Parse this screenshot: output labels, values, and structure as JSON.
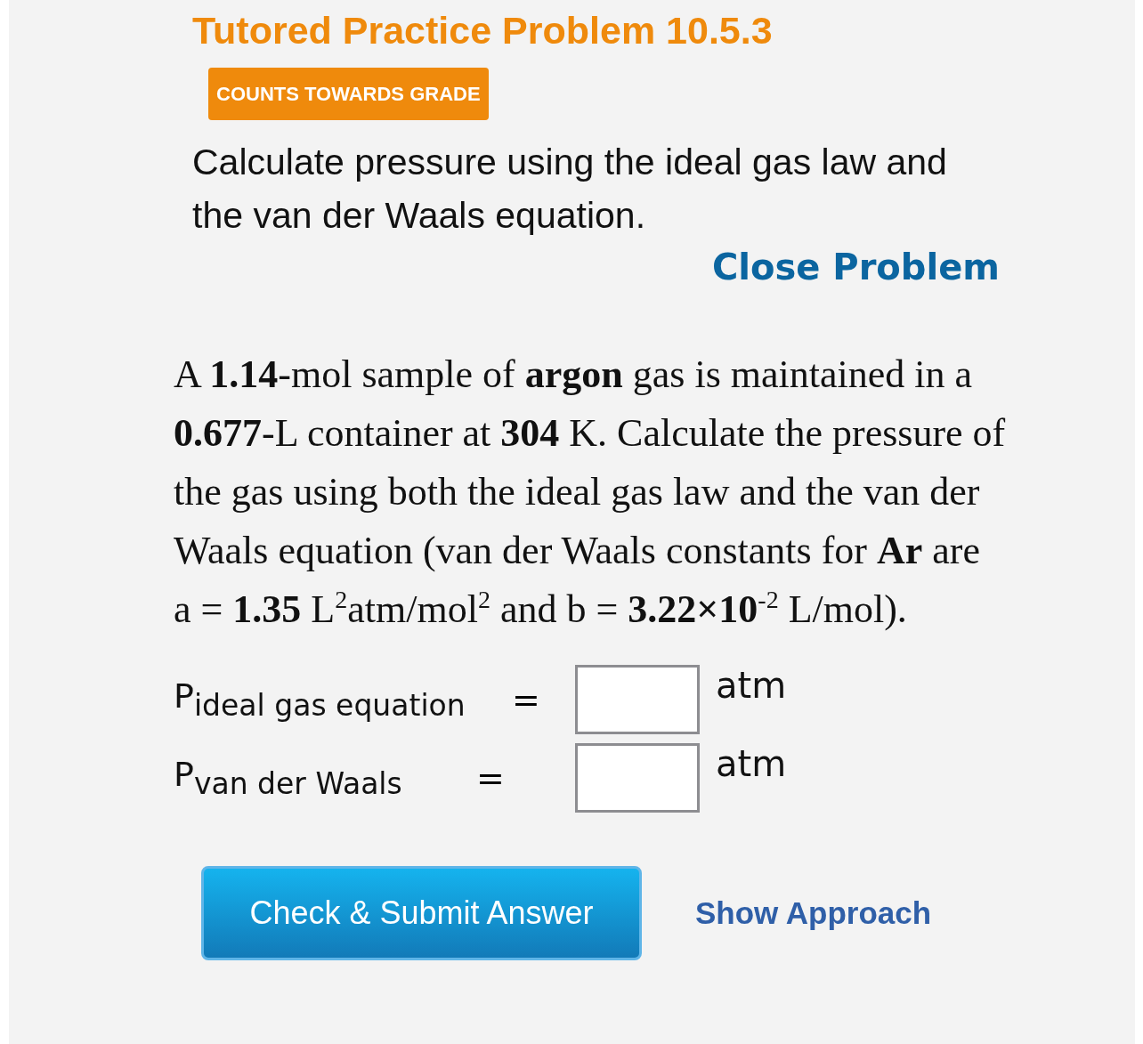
{
  "header": {
    "title": "Tutored Practice Problem 10.5.3",
    "badge": "COUNTS TOWARDS GRADE",
    "subtitle": "Calculate pressure using the ideal gas law and the van der Waals equation.",
    "close_link": "Close Problem"
  },
  "problem": {
    "text": "A **1.14**-mol sample of **argon** gas is maintained in a **0.677**-L container at **304** K. Calculate the pressure of the gas using both the ideal gas law and the van der Waals equation (van der Waals constants for **Ar** are a = **1.35** L$^{2}$atm/mol$^{2}$ and b = **3.22×10**$^{-2}$ L/mol)."
  },
  "answers": [
    {
      "label": "P$_{ideal gas equation}$",
      "equals": "=",
      "unit": "atm"
    },
    {
      "label": "P$_{van der Waals}$",
      "equals": "=",
      "unit": "atm"
    }
  ],
  "actions": {
    "submit": "Check & Submit Answer",
    "approach": "Show Approach"
  }
}
